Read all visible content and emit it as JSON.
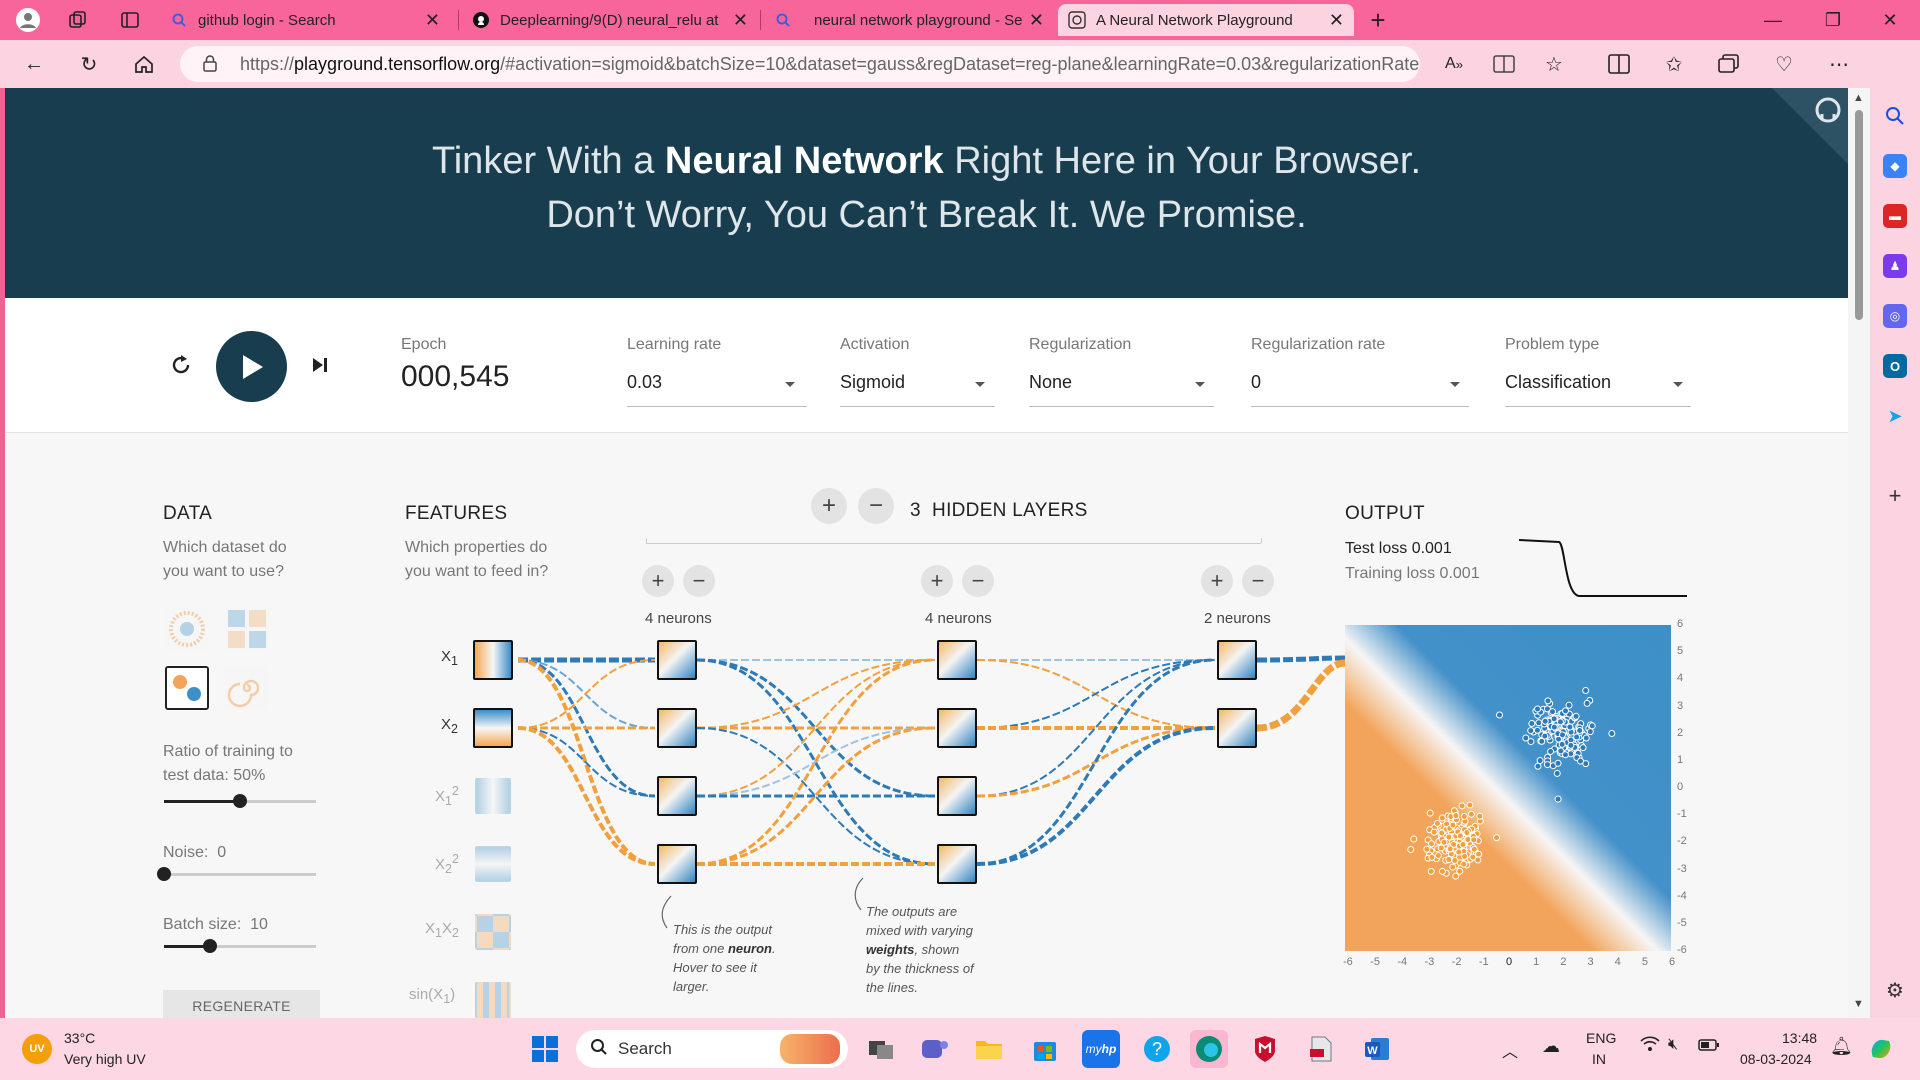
{
  "browser": {
    "tabs": [
      {
        "title": "github login - Search",
        "icon": "search-icon"
      },
      {
        "title": "Deeplearning/9(D) neural_relu at",
        "icon": "github-icon"
      },
      {
        "title": "neural network playground - Sea",
        "icon": "search-icon"
      },
      {
        "title": "A Neural Network Playground",
        "icon": "playground-icon",
        "active": true
      }
    ],
    "url_prefix": "https://",
    "url_host": "playground.tensorflow.org",
    "url_rest": "/#activation=sigmoid&batchSize=10&dataset=gauss&regDataset=reg-plane&learningRate=0.03&regularizationRate...",
    "tab_bar_color": "#f7659a",
    "address_bar_color": "#fbd3e1"
  },
  "hero": {
    "line1_pre": "Tinker With a",
    "line1_bold": "Neural Network",
    "line1_post": "Right Here in Your Browser.",
    "line2": "Don’t Worry, You Can’t Break It. We Promise.",
    "bg_color": "#183d4e"
  },
  "controls": {
    "epoch_label": "Epoch",
    "epoch_value": "000,545",
    "learning_rate_label": "Learning rate",
    "learning_rate_value": "0.03",
    "activation_label": "Activation",
    "activation_value": "Sigmoid",
    "regularization_label": "Regularization",
    "regularization_value": "None",
    "regularization_rate_label": "Regularization rate",
    "regularization_rate_value": "0",
    "problem_type_label": "Problem type",
    "problem_type_value": "Classification"
  },
  "data_panel": {
    "title": "DATA",
    "subtitle_line1": "Which dataset do",
    "subtitle_line2": "you want to use?",
    "ratio_label": "Ratio of training to",
    "ratio_label2": "test data:",
    "ratio_value": "50%",
    "ratio_fraction": 0.5,
    "noise_label": "Noise:",
    "noise_value": "0",
    "noise_fraction": 0,
    "batch_label": "Batch size:",
    "batch_value": "10",
    "batch_fraction": 0.3,
    "regenerate": "REGENERATE"
  },
  "features_panel": {
    "title": "FEATURES",
    "subtitle_line1": "Which properties do",
    "subtitle_line2": "you want to feed in?",
    "features": [
      {
        "base": "X",
        "sub": "1",
        "sup": ""
      },
      {
        "base": "X",
        "sub": "2",
        "sup": ""
      },
      {
        "base": "X",
        "sub": "1",
        "sup": "2"
      },
      {
        "base": "X",
        "sub": "2",
        "sup": "2"
      },
      {
        "base": "X",
        "sub": "1",
        "base2": "X",
        "sub2": "2"
      },
      {
        "base": "sin(X",
        "sub": "1",
        "post": ")"
      }
    ]
  },
  "network": {
    "hidden_layers_count": "3",
    "hidden_layers_label": "HIDDEN LAYERS",
    "layers": [
      {
        "label": "4 neurons"
      },
      {
        "label": "4 neurons"
      },
      {
        "label": "2 neurons"
      }
    ],
    "annotation1": [
      "This is the output",
      "from one",
      "neuron",
      ".",
      "Hover to see it",
      "larger."
    ],
    "annotation2": [
      "The outputs are",
      "mixed with varying",
      "weights",
      ", shown",
      "by the thickness of",
      "the lines."
    ]
  },
  "output_panel": {
    "title": "OUTPUT",
    "test_loss": "Test loss 0.001",
    "training_loss": "Training loss 0.001",
    "y_ticks": [
      "6",
      "5",
      "4",
      "3",
      "2",
      "1",
      "0",
      "-1",
      "-2",
      "-3",
      "-4",
      "-5",
      "-6"
    ],
    "x_ticks": [
      "-6",
      "-5",
      "-4",
      "-3",
      "-2",
      "-1",
      "0",
      "1",
      "2",
      "3",
      "4",
      "5",
      "6"
    ],
    "positive_color": "#3d8fc8",
    "negative_color": "#f2a55a"
  },
  "taskbar": {
    "weather_temp": "33°C",
    "weather_desc": "Very high UV",
    "weather_badge": "UV",
    "search_placeholder": "Search",
    "lang_top": "ENG",
    "lang_bottom": "IN",
    "time": "13:48",
    "date": "08-03-2024"
  }
}
